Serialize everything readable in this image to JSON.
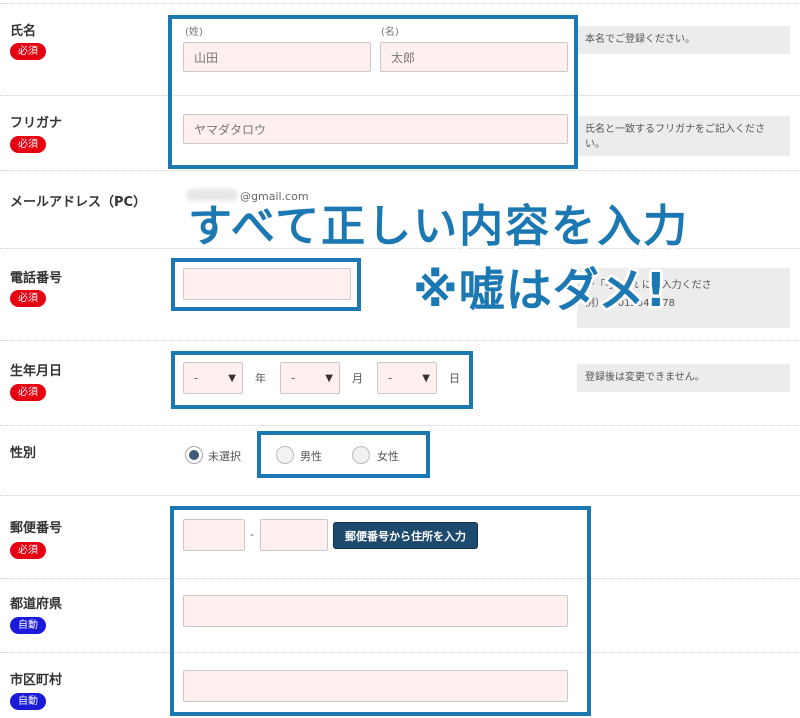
{
  "fields": {
    "name": {
      "label": "氏名",
      "badge": "必須",
      "sei_label": "(姓)",
      "mei_label": "(名)",
      "sei_value": "山田",
      "mei_value": "太郎",
      "note": "本名でご登録ください。"
    },
    "furigana": {
      "label": "フリガナ",
      "badge": "必須",
      "value": "ヤマダタロウ",
      "note": "氏名と一致するフリガナをご記入ください。"
    },
    "email": {
      "label": "メールアドレス（PC）",
      "visible_tail": "@gmail.com"
    },
    "phone": {
      "label": "電話番号",
      "badge": "必須",
      "note_line1": "ン「-」…れ  にご入力くださ",
      "note_line2": "例）09012345678"
    },
    "birthday": {
      "label": "生年月日",
      "badge": "必須",
      "year_value": "-",
      "month_value": "-",
      "day_value": "-",
      "year_unit": "年",
      "month_unit": "月",
      "day_unit": "日",
      "note": "登録後は変更できません。"
    },
    "gender": {
      "label": "性別",
      "options": [
        "未選択",
        "男性",
        "女性"
      ],
      "selected": "未選択"
    },
    "postal": {
      "label": "郵便番号",
      "badge": "必須",
      "separator": "-",
      "button_label": "郵便番号から住所を入力"
    },
    "prefecture": {
      "label": "都道府県",
      "badge": "自動"
    },
    "city": {
      "label": "市区町村",
      "badge": "自動"
    }
  },
  "overlay": {
    "line1": "すべて正しい内容を入力",
    "line2": "※嘘はダメ!"
  },
  "colors": {
    "highlight": "#1c78b2",
    "required_badge": "#e50012",
    "auto_badge": "#1a1ad8",
    "input_bg": "#fff0ef",
    "button_bg": "#1e4a6e"
  }
}
